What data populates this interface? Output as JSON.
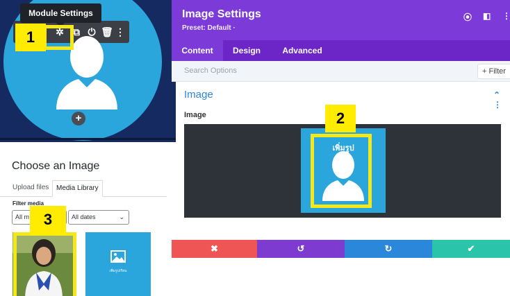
{
  "module_panel": {
    "tooltip": "Module Settings",
    "step_badge": "1",
    "toolbar_icons": [
      "move-icon",
      "gear-icon",
      "duplicate-icon",
      "power-icon",
      "trash-icon",
      "more-icon"
    ],
    "add_button": "+"
  },
  "settings_panel": {
    "title": "Image Settings",
    "preset": "Preset: Default ·",
    "tabs": [
      {
        "label": "Content",
        "active": true
      },
      {
        "label": "Design",
        "active": false
      },
      {
        "label": "Advanced",
        "active": false
      }
    ],
    "search_placeholder": "Search Options",
    "filter_label": "+ Filter",
    "section_title": "Image",
    "section_toggle": "⌃ ⋮",
    "field_label": "Image",
    "upload_label": "เพิ่มรูป",
    "step_badge": "2",
    "actions": [
      {
        "name": "discard",
        "glyph": "✖",
        "color": "#ef5555"
      },
      {
        "name": "undo",
        "glyph": "↺",
        "color": "#7e3bd0"
      },
      {
        "name": "redo",
        "glyph": "↻",
        "color": "#2b87da"
      },
      {
        "name": "save",
        "glyph": "✔",
        "color": "#29c4a9"
      }
    ]
  },
  "media_panel": {
    "title": "Choose an Image",
    "tabs": [
      {
        "label": "Upload files",
        "active": false
      },
      {
        "label": "Media Library",
        "active": true
      }
    ],
    "filter_label": "Filter media",
    "type_select": "All m",
    "date_select": "All dates",
    "step_badge": "3",
    "thumb2_caption": "เพิ่มรูปเรียน"
  },
  "colors": {
    "purple": "#7c3ad8",
    "blue": "#2aa6dc",
    "highlight": "#f5e81a",
    "badge": "#ffec00"
  }
}
